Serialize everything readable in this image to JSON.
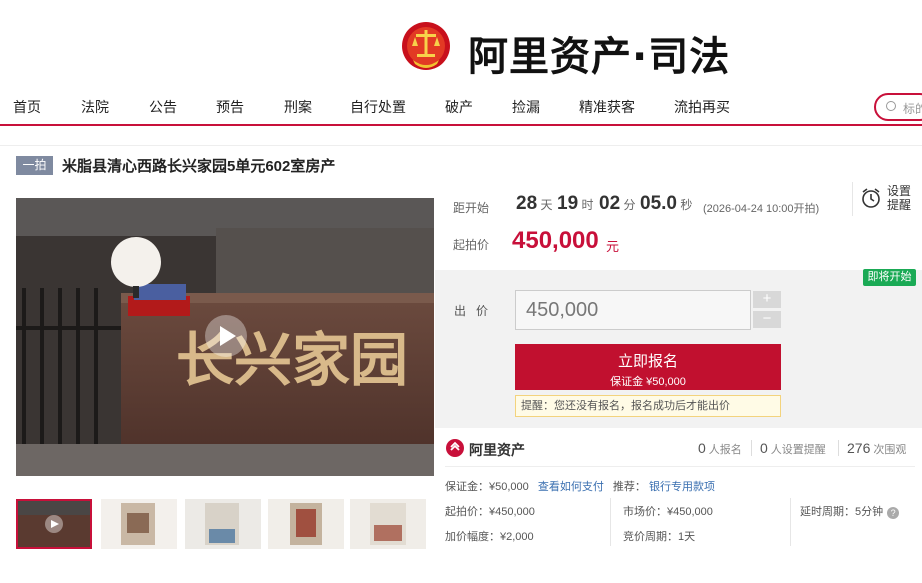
{
  "header": {
    "logo_text": "阿里资产·司法"
  },
  "nav": {
    "items": [
      "首页",
      "法院",
      "公告",
      "预告",
      "刑案",
      "自行处置",
      "破产",
      "捡漏",
      "精准获客",
      "流拍再买"
    ],
    "search_placeholder": "标的"
  },
  "item": {
    "round": "一拍",
    "title": "米脂县清心西路长兴家园5单元602室房产",
    "main_image_sign_text": "长兴家园"
  },
  "countdown": {
    "label": "距开始",
    "days": "28",
    "days_unit": "天",
    "hours": "19",
    "hours_unit": "时",
    "minutes": "02",
    "minutes_unit": "分",
    "seconds": "05.0",
    "seconds_unit": "秒",
    "start_time": "(2026-04-24 10:00开拍)",
    "remind_label": "设置提醒"
  },
  "price": {
    "label": "起拍价",
    "value": "450,000",
    "unit": "元"
  },
  "bid": {
    "status_badge": "即将开始",
    "label": "出价",
    "input_value": "450,000",
    "plus": "+",
    "minus": "−",
    "signup_label": "立即报名",
    "signup_deposit": "保证金 ¥50,000",
    "tip": "提醒：您还没有报名，报名成功后才能出价"
  },
  "stats": {
    "brand": "阿里资产",
    "signups": "0",
    "signups_label": "人报名",
    "reminders": "0",
    "reminders_label": "人设置提醒",
    "views": "276",
    "views_label": "次围观"
  },
  "details": {
    "deposit": "保证金：¥50,000",
    "deposit_link": "查看如何支付",
    "recommend_label": "推荐：",
    "recommend_link": "银行专用款项",
    "start_price": "起拍价：¥450,000",
    "market_price": "市场价：¥450,000",
    "extension": "延时周期：5分钟",
    "increment": "加价幅度：¥2,000",
    "bid_cycle": "竞价周期：1天"
  },
  "colors": {
    "brand": "#c8103a",
    "badge_green": "#1aaa55",
    "link": "#3a6fb0"
  }
}
